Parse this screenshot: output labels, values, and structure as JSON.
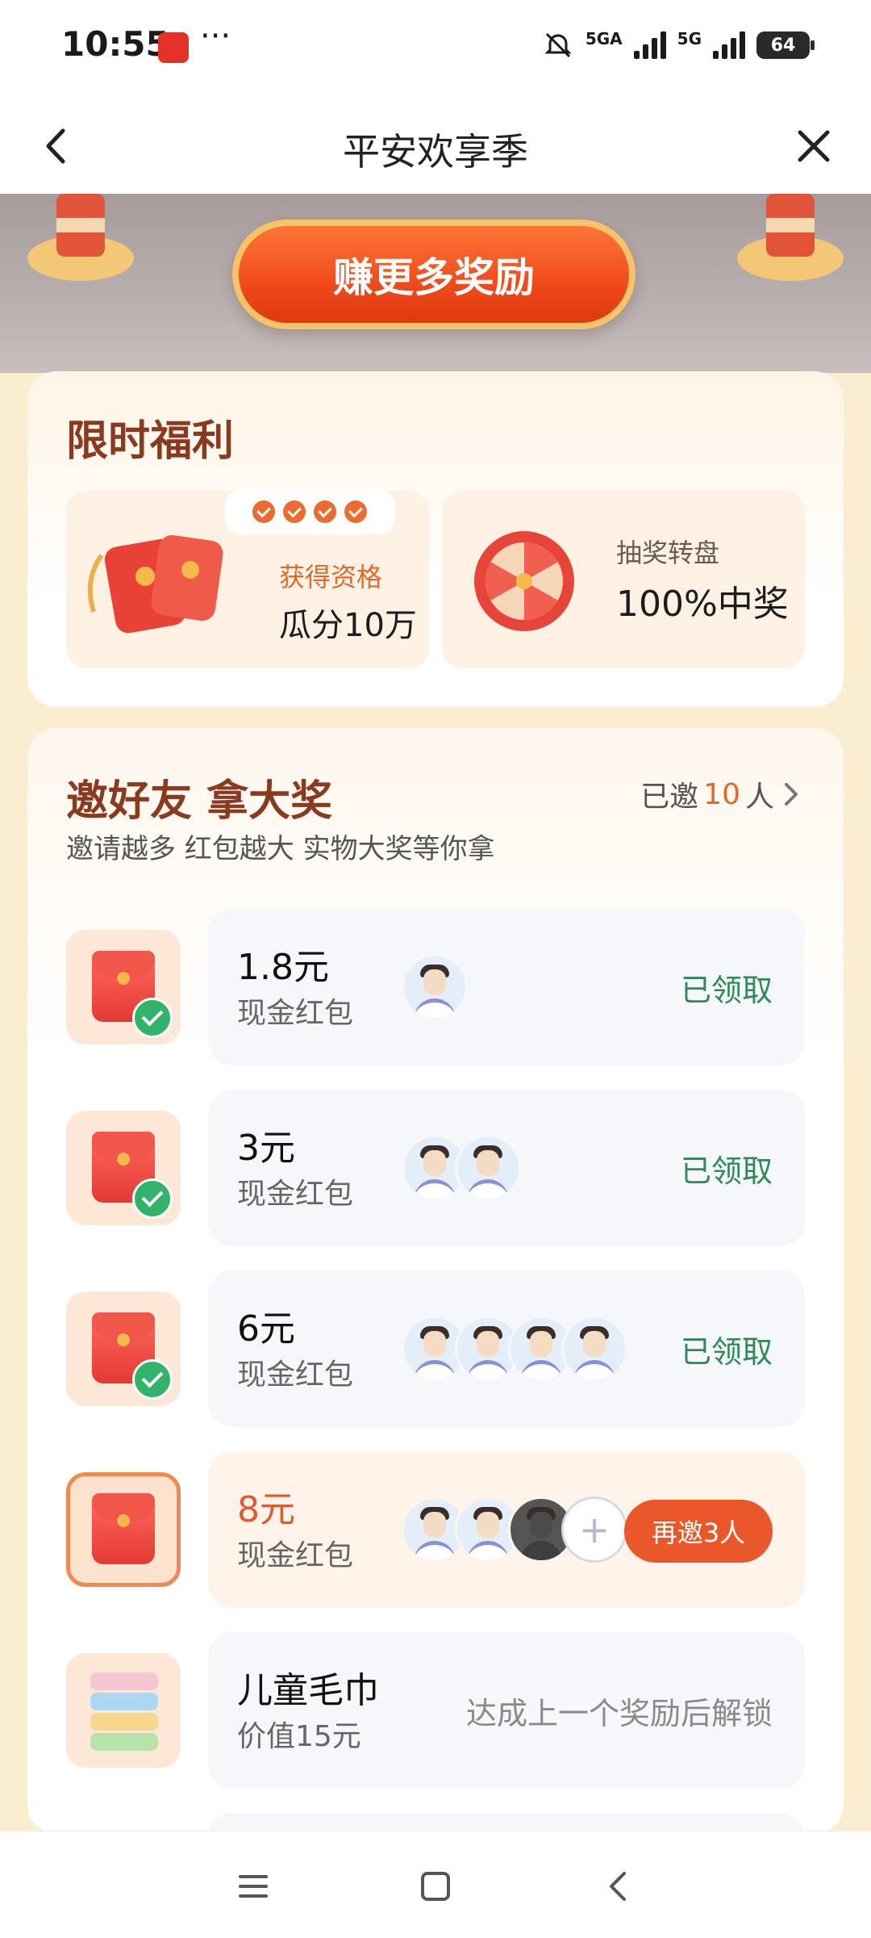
{
  "status_bar": {
    "time": "10:55",
    "dots": "···",
    "network1": "5GA",
    "network2": "5G",
    "battery": "64",
    "icons": [
      "tmall-app-icon",
      "mute-icon",
      "signal-icon",
      "signal-icon",
      "battery-icon"
    ]
  },
  "nav": {
    "title": "平安欢享季",
    "back_icon": "chevron-left-icon",
    "close_icon": "close-icon"
  },
  "hero": {
    "button_label": "赚更多奖励"
  },
  "limited": {
    "heading": "限时福利",
    "tiles": [
      {
        "label": "获得资格",
        "value": "瓜分10万",
        "icon": "red-envelopes-icon"
      },
      {
        "label": "抽奖转盘",
        "value": "100%中奖",
        "icon": "lucky-wheel-icon"
      }
    ]
  },
  "invite": {
    "heading": "邀好友 拿大奖",
    "subtitle": "邀请越多 红包越大 实物大奖等你拿",
    "invited_prefix": "已邀",
    "invited_count": "10",
    "invited_suffix": "人",
    "rewards": [
      {
        "amount": "1.8元",
        "kind": "现金红包",
        "status": "已领取"
      },
      {
        "amount": "3元",
        "kind": "现金红包",
        "status": "已领取"
      },
      {
        "amount": "6元",
        "kind": "现金红包",
        "status": "已领取"
      },
      {
        "amount": "8元",
        "kind": "现金红包",
        "cta": "再邀3人"
      },
      {
        "amount": "儿童毛巾",
        "kind": "价值15元",
        "status": "达成上一个奖励后解锁"
      }
    ]
  },
  "bottom_nav": {
    "icons": [
      "menu-icon",
      "home-icon",
      "back-icon"
    ]
  },
  "colors": {
    "accent": "#e9572a",
    "claimed": "#2f8a58",
    "heading": "#8a3b1f"
  }
}
